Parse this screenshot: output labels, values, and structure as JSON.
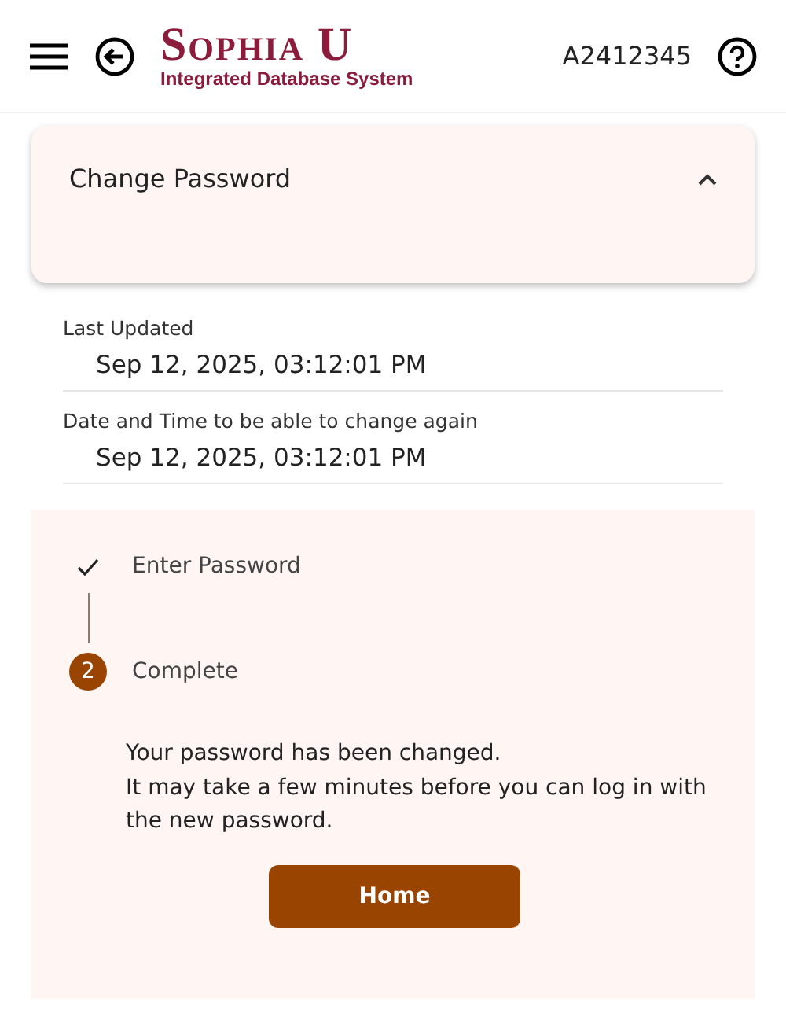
{
  "header": {
    "logo_title": "Sophia U",
    "logo_subtitle": "Integrated Database System",
    "user_id": "A2412345"
  },
  "panel": {
    "title": "Change Password",
    "expanded": true
  },
  "fields": [
    {
      "label": "Last Updated",
      "value": "Sep 12, 2025, 03:12:01 PM"
    },
    {
      "label": "Date and Time to be able to change again",
      "value": "Sep 12, 2025, 03:12:01 PM"
    }
  ],
  "steps": [
    {
      "kind": "done",
      "label": "Enter Password"
    },
    {
      "kind": "current",
      "number": "2",
      "label": "Complete"
    }
  ],
  "messages": [
    "Your password has been changed.",
    "It may take a few minutes before you can log in with the new password."
  ],
  "home_button": "Home"
}
